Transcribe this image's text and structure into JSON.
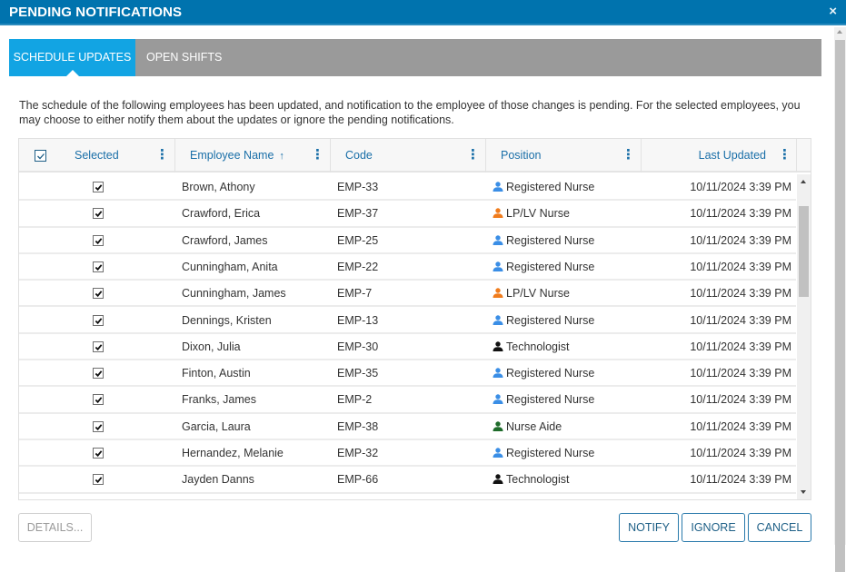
{
  "window": {
    "title": "PENDING NOTIFICATIONS",
    "close_icon": "×"
  },
  "tabs": [
    {
      "label": "SCHEDULE UPDATES",
      "active": true
    },
    {
      "label": "OPEN SHIFTS",
      "active": false
    }
  ],
  "description": "The schedule of the following employees has been updated, and notification to the employee of those changes is pending. For the selected employees, you may choose to either notify them about the updates or ignore the pending notifications.",
  "grid": {
    "select_all_checked": true,
    "columns": [
      {
        "label": "Selected"
      },
      {
        "label": "Employee Name",
        "sort": "ascending",
        "sort_icon": "↑"
      },
      {
        "label": "Code"
      },
      {
        "label": "Position"
      },
      {
        "label": "Last Updated"
      }
    ],
    "column_menu_icon": "⋮",
    "position_colors": {
      "Registered Nurse": "#3a8ee6",
      "LP/LV Nurse": "#f07c1c",
      "Technologist": "#111111",
      "Nurse Aide": "#1e6b2a"
    },
    "rows": [
      {
        "selected": true,
        "name": "Brown, Athony",
        "code": "EMP-33",
        "position": "Registered Nurse",
        "last_updated": "10/11/2024 3:39 PM"
      },
      {
        "selected": true,
        "name": "Crawford, Erica",
        "code": "EMP-37",
        "position": "LP/LV Nurse",
        "last_updated": "10/11/2024 3:39 PM"
      },
      {
        "selected": true,
        "name": "Crawford, James",
        "code": "EMP-25",
        "position": "Registered Nurse",
        "last_updated": "10/11/2024 3:39 PM"
      },
      {
        "selected": true,
        "name": "Cunningham, Anita",
        "code": "EMP-22",
        "position": "Registered Nurse",
        "last_updated": "10/11/2024 3:39 PM"
      },
      {
        "selected": true,
        "name": "Cunningham, James",
        "code": "EMP-7",
        "position": "LP/LV Nurse",
        "last_updated": "10/11/2024 3:39 PM"
      },
      {
        "selected": true,
        "name": "Dennings, Kristen",
        "code": "EMP-13",
        "position": "Registered Nurse",
        "last_updated": "10/11/2024 3:39 PM"
      },
      {
        "selected": true,
        "name": "Dixon, Julia",
        "code": "EMP-30",
        "position": "Technologist",
        "last_updated": "10/11/2024 3:39 PM"
      },
      {
        "selected": true,
        "name": "Finton, Austin",
        "code": "EMP-35",
        "position": "Registered Nurse",
        "last_updated": "10/11/2024 3:39 PM"
      },
      {
        "selected": true,
        "name": "Franks, James",
        "code": "EMP-2",
        "position": "Registered Nurse",
        "last_updated": "10/11/2024 3:39 PM"
      },
      {
        "selected": true,
        "name": "Garcia, Laura",
        "code": "EMP-38",
        "position": "Nurse Aide",
        "last_updated": "10/11/2024 3:39 PM"
      },
      {
        "selected": true,
        "name": "Hernandez, Melanie",
        "code": "EMP-32",
        "position": "Registered Nurse",
        "last_updated": "10/11/2024 3:39 PM"
      },
      {
        "selected": true,
        "name": "Jayden Danns",
        "code": "EMP-66",
        "position": "Technologist",
        "last_updated": "10/11/2024 3:39 PM"
      }
    ]
  },
  "buttons": {
    "details": "DETAILS...",
    "notify": "NOTIFY",
    "ignore": "IGNORE",
    "cancel": "CANCEL"
  },
  "colors": {
    "titlebar": "#0073ae",
    "active_tab": "#12a4e3",
    "tab_strip": "#9a9a9a",
    "header_text": "#1a6fa8"
  }
}
